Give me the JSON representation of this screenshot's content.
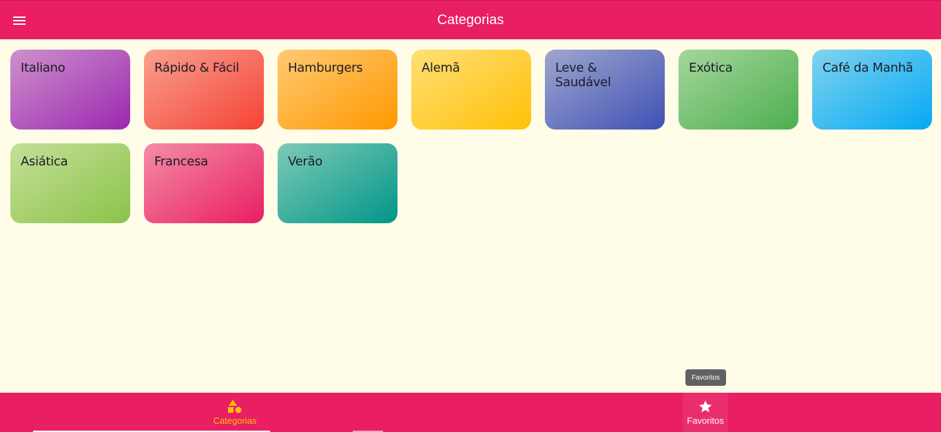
{
  "appbar": {
    "title": "Categorias",
    "menu_icon": "hamburger-menu-icon"
  },
  "categories": [
    {
      "title": "Italiano",
      "color": "#9c27b0"
    },
    {
      "title": "Rápido & Fácil",
      "color": "#f44336"
    },
    {
      "title": "Hamburgers",
      "color": "#ff9800"
    },
    {
      "title": "Alemã",
      "color": "#ffc107"
    },
    {
      "title": "Leve & Saudável",
      "color": "#3f51b5"
    },
    {
      "title": "Exótica",
      "color": "#4caf50"
    },
    {
      "title": "Café da Manhã",
      "color": "#03a9f4"
    },
    {
      "title": "Asiática",
      "color": "#8bc34a"
    },
    {
      "title": "Francesa",
      "color": "#e91e63"
    },
    {
      "title": "Verão",
      "color": "#009688"
    }
  ],
  "bottom_nav": {
    "items": [
      {
        "label": "Categorias",
        "icon": "category-icon",
        "active": true
      },
      {
        "label": "Favoritos",
        "icon": "star-icon",
        "active": false
      }
    ],
    "tooltip": "Favoritos"
  },
  "colors": {
    "primary": "#e91e63",
    "accent": "#ffc107",
    "background": "#fffde7"
  }
}
